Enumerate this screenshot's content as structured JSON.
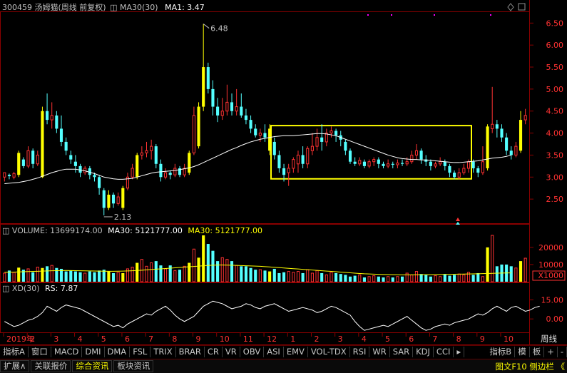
{
  "header": {
    "stock": "300459 汤姆猫(周线 前复权)",
    "ma": "MA30(30)",
    "ma1": "MA1: 3.47",
    "stock_color": "#c0c0c0",
    "ma_color": "#ffffff"
  },
  "vol_header": {
    "vol": "VOLUME: 13699174.00",
    "ma30a": "MA30: 5121777.00",
    "ma30b": "MA30: 5121777.00"
  },
  "xd_header": {
    "xd": "XD(30)",
    "rs": "RS: 7.87"
  },
  "time_tab": "周线",
  "toolbar": {
    "left": [
      "指标A",
      "窗口",
      "MACD",
      "DMI",
      "DMA",
      "FSL",
      "TRIX",
      "BRAR",
      "CR",
      "VR",
      "OBV",
      "ASI",
      "EMV",
      "VOL-TDX",
      "RSI",
      "WR",
      "SAR",
      "KDJ",
      "CCI"
    ],
    "right": [
      "指标B",
      "模",
      "板",
      "+",
      "-"
    ],
    "nav_icon": "triangle-right-icon"
  },
  "bottom_bar": {
    "items": [
      "扩展",
      "关联报价",
      "综合资讯",
      "板块资讯"
    ],
    "expand_icon": "caret-up-icon",
    "right": "图文F10 侧边栏 《"
  },
  "colors": {
    "up": "#ff3232",
    "down": "#54ffff",
    "highlight": "#ffff00",
    "ma": "#ffffff",
    "grid": "#8b0000"
  },
  "chart_data": [
    {
      "type": "candlestick",
      "title": "300459 汤姆猫(周线 前复权)",
      "ylim": [
        2.0,
        6.7
      ],
      "yticks": [
        "6.50",
        "6.00",
        "5.50",
        "5.00",
        "4.50",
        "4.00",
        "3.50",
        "3.00",
        "2.50"
      ],
      "annotations": [
        {
          "label": "6.48",
          "type": "max"
        },
        {
          "label": "2.13",
          "type": "min"
        }
      ],
      "xlabels": [
        "2019年",
        "2",
        "3",
        "4",
        "5",
        "6",
        "7",
        "8",
        "9",
        "10",
        "11",
        "12",
        "1",
        "2",
        "3",
        "4",
        "5",
        "6",
        "7",
        "8",
        "9",
        "10"
      ],
      "highlight_box": {
        "ymin": 2.96,
        "ymax": 4.17
      },
      "candles": [
        [
          3.0,
          3.1,
          2.9,
          3.05,
          0
        ],
        [
          3.05,
          3.02,
          2.95,
          3.08,
          0
        ],
        [
          3.0,
          3.08,
          2.95,
          3.12,
          0
        ],
        [
          3.05,
          3.55,
          3.0,
          3.6,
          1
        ],
        [
          3.4,
          3.25,
          3.2,
          3.45,
          0
        ],
        [
          3.25,
          3.6,
          3.2,
          3.7,
          0
        ],
        [
          3.6,
          3.3,
          3.2,
          3.65,
          0
        ],
        [
          3.3,
          3.5,
          3.25,
          3.6,
          0
        ],
        [
          3.0,
          4.5,
          2.98,
          4.6,
          1
        ],
        [
          4.5,
          4.3,
          4.2,
          4.9,
          0
        ],
        [
          4.3,
          4.4,
          4.1,
          4.7,
          0
        ],
        [
          4.4,
          4.1,
          4.0,
          4.5,
          0
        ],
        [
          4.1,
          3.8,
          3.7,
          4.4,
          0
        ],
        [
          3.8,
          3.6,
          3.5,
          3.9,
          0
        ],
        [
          3.5,
          3.4,
          3.3,
          3.6,
          0
        ],
        [
          3.35,
          3.25,
          3.1,
          3.5,
          0
        ],
        [
          3.25,
          3.1,
          3.0,
          3.3,
          0
        ],
        [
          3.1,
          3.2,
          3.05,
          3.25,
          0
        ],
        [
          3.2,
          3.05,
          2.95,
          3.25,
          0
        ],
        [
          3.05,
          3.0,
          2.9,
          3.1,
          0
        ],
        [
          3.0,
          2.75,
          2.6,
          3.05,
          0
        ],
        [
          2.7,
          2.3,
          2.13,
          2.75,
          0
        ],
        [
          2.3,
          2.6,
          2.25,
          2.7,
          1
        ],
        [
          2.6,
          2.4,
          2.3,
          2.65,
          0
        ],
        [
          2.4,
          2.55,
          2.35,
          2.65,
          0
        ],
        [
          2.3,
          2.75,
          2.25,
          2.8,
          1
        ],
        [
          2.75,
          3.0,
          2.7,
          3.1,
          0
        ],
        [
          3.0,
          3.2,
          2.95,
          3.3,
          0
        ],
        [
          3.0,
          3.5,
          2.95,
          3.55,
          1
        ],
        [
          3.5,
          3.55,
          3.4,
          3.7,
          0
        ],
        [
          3.55,
          3.6,
          3.45,
          3.8,
          0
        ],
        [
          3.6,
          3.7,
          3.4,
          3.85,
          0
        ],
        [
          3.7,
          3.3,
          3.2,
          3.75,
          0
        ],
        [
          3.3,
          3.0,
          2.9,
          3.4,
          0
        ],
        [
          3.0,
          3.1,
          2.95,
          3.2,
          0
        ],
        [
          3.1,
          3.05,
          2.95,
          3.15,
          0
        ],
        [
          3.05,
          3.2,
          3.0,
          3.3,
          0
        ],
        [
          3.2,
          3.05,
          3.0,
          3.25,
          0
        ],
        [
          3.05,
          3.2,
          3.0,
          3.3,
          0
        ],
        [
          3.1,
          3.55,
          3.05,
          3.6,
          1
        ],
        [
          3.55,
          4.4,
          3.5,
          4.6,
          0
        ],
        [
          3.7,
          4.6,
          3.65,
          4.7,
          1
        ],
        [
          4.6,
          5.5,
          4.5,
          6.48,
          1
        ],
        [
          5.5,
          5.0,
          4.9,
          5.6,
          0
        ],
        [
          5.0,
          4.6,
          4.4,
          5.2,
          0
        ],
        [
          4.6,
          4.4,
          4.25,
          4.8,
          0
        ],
        [
          4.4,
          4.5,
          4.3,
          4.8,
          0
        ],
        [
          4.5,
          4.7,
          4.4,
          5.1,
          0
        ],
        [
          4.7,
          4.5,
          4.4,
          4.9,
          0
        ],
        [
          4.5,
          4.6,
          4.4,
          5.0,
          0
        ],
        [
          4.6,
          4.4,
          4.35,
          4.9,
          0
        ],
        [
          4.4,
          4.3,
          4.2,
          4.55,
          0
        ],
        [
          4.3,
          4.1,
          4.0,
          4.4,
          0
        ],
        [
          4.1,
          3.95,
          3.9,
          4.2,
          0
        ],
        [
          3.95,
          4.0,
          3.8,
          4.1,
          0
        ],
        [
          4.0,
          3.9,
          3.8,
          4.2,
          0
        ],
        [
          3.6,
          4.1,
          3.5,
          4.2,
          1
        ],
        [
          3.8,
          3.5,
          3.4,
          3.9,
          0
        ],
        [
          3.5,
          3.2,
          3.1,
          3.6,
          0
        ],
        [
          3.2,
          3.05,
          2.9,
          3.3,
          0
        ],
        [
          3.1,
          3.2,
          2.8,
          3.3,
          0
        ],
        [
          3.2,
          3.4,
          3.1,
          3.45,
          0
        ],
        [
          3.3,
          3.5,
          3.1,
          3.6,
          0
        ],
        [
          3.5,
          3.3,
          3.2,
          3.7,
          0
        ],
        [
          3.3,
          3.65,
          3.2,
          3.7,
          0
        ],
        [
          3.6,
          3.7,
          3.5,
          4.0,
          0
        ],
        [
          3.7,
          3.9,
          3.6,
          4.1,
          0
        ],
        [
          3.9,
          3.8,
          3.6,
          4.2,
          0
        ],
        [
          3.8,
          4.0,
          3.7,
          4.1,
          0
        ],
        [
          4.0,
          4.05,
          3.9,
          4.15,
          0
        ],
        [
          4.05,
          3.95,
          3.8,
          4.1,
          0
        ],
        [
          3.95,
          3.85,
          3.7,
          4.05,
          0
        ],
        [
          3.8,
          3.6,
          3.5,
          3.85,
          0
        ],
        [
          3.6,
          3.35,
          3.3,
          3.65,
          0
        ],
        [
          3.35,
          3.3,
          3.25,
          3.45,
          0
        ],
        [
          3.3,
          3.38,
          3.25,
          3.45,
          0
        ],
        [
          3.35,
          3.25,
          3.2,
          3.4,
          0
        ],
        [
          3.25,
          3.35,
          3.2,
          3.4,
          0
        ],
        [
          3.35,
          3.4,
          3.25,
          3.45,
          0
        ],
        [
          3.4,
          3.3,
          3.2,
          3.45,
          0
        ],
        [
          3.3,
          3.25,
          3.2,
          3.35,
          0
        ],
        [
          3.25,
          3.3,
          3.2,
          3.4,
          0
        ],
        [
          3.3,
          3.28,
          3.2,
          3.35,
          0
        ],
        [
          3.28,
          3.32,
          3.2,
          3.4,
          0
        ],
        [
          3.32,
          3.3,
          3.25,
          3.4,
          0
        ],
        [
          3.3,
          3.35,
          3.25,
          3.45,
          0
        ],
        [
          3.35,
          3.5,
          3.3,
          3.6,
          0
        ],
        [
          3.5,
          3.6,
          3.4,
          3.75,
          0
        ],
        [
          3.6,
          3.4,
          3.3,
          3.65,
          0
        ],
        [
          3.4,
          3.35,
          3.25,
          3.5,
          0
        ],
        [
          3.35,
          3.25,
          3.15,
          3.4,
          0
        ],
        [
          3.25,
          3.3,
          3.2,
          3.35,
          0
        ],
        [
          3.3,
          3.35,
          3.25,
          3.45,
          0
        ],
        [
          3.35,
          3.25,
          3.15,
          3.4,
          0
        ],
        [
          3.25,
          3.1,
          3.0,
          3.3,
          0
        ],
        [
          3.1,
          3.0,
          2.95,
          3.15,
          0
        ],
        [
          3.0,
          3.1,
          2.95,
          3.2,
          0
        ],
        [
          3.1,
          3.2,
          3.05,
          3.3,
          0
        ],
        [
          3.2,
          3.35,
          3.1,
          3.4,
          0
        ],
        [
          3.35,
          3.2,
          3.1,
          3.4,
          0
        ],
        [
          3.2,
          3.1,
          3.0,
          3.25,
          0
        ],
        [
          3.1,
          3.35,
          3.05,
          3.7,
          0
        ],
        [
          3.2,
          4.15,
          3.15,
          4.2,
          1
        ],
        [
          4.1,
          4.2,
          4.0,
          5.05,
          0
        ],
        [
          4.2,
          4.1,
          3.9,
          4.3,
          0
        ],
        [
          4.1,
          3.9,
          3.8,
          4.2,
          0
        ],
        [
          3.9,
          3.6,
          3.5,
          4.0,
          0
        ],
        [
          3.6,
          3.5,
          3.4,
          3.7,
          0
        ],
        [
          3.5,
          3.7,
          3.45,
          3.8,
          0
        ],
        [
          3.6,
          4.3,
          3.55,
          4.5,
          1
        ],
        [
          4.3,
          4.4,
          4.2,
          4.55,
          0
        ]
      ],
      "ma30": [
        2.85,
        2.86,
        2.87,
        2.88,
        2.9,
        2.92,
        2.95,
        2.98,
        3.02,
        3.06,
        3.1,
        3.13,
        3.16,
        3.18,
        3.18,
        3.18,
        3.16,
        3.14,
        3.11,
        3.08,
        3.04,
        3.0,
        2.98,
        2.96,
        2.95,
        2.95,
        2.96,
        2.97,
        3.0,
        3.03,
        3.06,
        3.09,
        3.11,
        3.12,
        3.13,
        3.14,
        3.15,
        3.17,
        3.19,
        3.21,
        3.24,
        3.28,
        3.33,
        3.38,
        3.43,
        3.48,
        3.53,
        3.58,
        3.63,
        3.67,
        3.72,
        3.76,
        3.8,
        3.83,
        3.86,
        3.88,
        3.9,
        3.92,
        3.93,
        3.94,
        3.94,
        3.94,
        3.95,
        3.96,
        3.97,
        3.98,
        3.99,
        3.99,
        3.98,
        3.96,
        3.94,
        3.9,
        3.86,
        3.82,
        3.78,
        3.74,
        3.7,
        3.66,
        3.62,
        3.58,
        3.54,
        3.5,
        3.47,
        3.44,
        3.42,
        3.41,
        3.4,
        3.4,
        3.39,
        3.39,
        3.38,
        3.37,
        3.36,
        3.35,
        3.34,
        3.33,
        3.33,
        3.34,
        3.35,
        3.36,
        3.37,
        3.39,
        3.41,
        3.43,
        3.44,
        3.45,
        3.47,
        3.5
      ]
    },
    {
      "type": "bar",
      "title": "VOLUME",
      "ylim": [
        0,
        27000
      ],
      "yticks": [
        "20000",
        "10000",
        "X1000"
      ],
      "values_k": [
        5000,
        6500,
        5500,
        8200,
        7000,
        7500,
        5500,
        8500,
        8000,
        9000,
        9500,
        8000,
        7500,
        6000,
        6500,
        6000,
        5500,
        5000,
        6000,
        5500,
        6500,
        7000,
        6000,
        5000,
        5500,
        5000,
        7500,
        8500,
        11000,
        13000,
        9000,
        11000,
        12000,
        9500,
        7500,
        9500,
        6500,
        7000,
        9000,
        11000,
        19000,
        14000,
        27000,
        22000,
        18000,
        12000,
        14000,
        13000,
        12000,
        9500,
        9000,
        9000,
        8000,
        7000,
        7000,
        6500,
        6000,
        7500,
        5000,
        5500,
        6000,
        5500,
        6000,
        5000,
        7000,
        5000,
        6500,
        5000,
        4000,
        5500,
        5000,
        4500,
        4000,
        3000,
        3500,
        4000,
        2500,
        3000,
        3500,
        3000,
        2500,
        3000,
        2500,
        3000,
        3000,
        5000,
        4000,
        6000,
        4500,
        4000,
        3000,
        3500,
        3000,
        4500,
        3500,
        4000,
        4500,
        4000,
        5500,
        4000,
        5000,
        3000,
        20000,
        27000,
        9000,
        10000,
        10000,
        9000,
        8000,
        12000,
        13700
      ],
      "ma30_k": [
        5500,
        5550,
        5600,
        5700,
        5800,
        5900,
        6000,
        6100,
        6200,
        6300,
        6400,
        6450,
        6500,
        6550,
        6500,
        6450,
        6400,
        6350,
        6300,
        6250,
        6200,
        6150,
        6100,
        6100,
        6150,
        6200,
        6300,
        6400,
        6550,
        6700,
        6900,
        7100,
        7300,
        7500,
        7700,
        7900,
        8100,
        8300,
        8500,
        8700,
        8900,
        9100,
        9300,
        9500,
        9600,
        9700,
        9700,
        9650,
        9600,
        9500,
        9400,
        9300,
        9200,
        9100,
        9000,
        8800,
        8600,
        8400,
        8200,
        8000,
        7800,
        7600,
        7400,
        7200,
        7000,
        6800,
        6600,
        6400,
        6200,
        6000,
        5800,
        5600,
        5400,
        5200,
        5000,
        4800,
        4600,
        4500,
        4400,
        4300,
        4200,
        4150,
        4100,
        4050,
        4000,
        4000,
        4000,
        4050,
        4100,
        4100,
        4100,
        4150,
        4200,
        4250,
        4300,
        4350,
        4400,
        4450,
        4500,
        4550,
        4600,
        4700,
        4800,
        4900,
        5000,
        5050,
        5100,
        5121
      ]
    },
    {
      "type": "line",
      "title": "XD(30)",
      "ylim": [
        -10,
        22
      ],
      "yticks": [
        "15.00",
        "0.00"
      ],
      "values": [
        -2,
        -4,
        -6,
        -5,
        -3,
        -1,
        0,
        2,
        5,
        10,
        8,
        6,
        9,
        11,
        10,
        9,
        8,
        6,
        4,
        2,
        0,
        -2,
        -4,
        -6,
        -5,
        -7,
        -4,
        -2,
        0,
        2,
        4,
        3,
        6,
        8,
        10,
        7,
        3,
        0,
        -2,
        0,
        2,
        6,
        10,
        12,
        14,
        13,
        12,
        10,
        8,
        9,
        10,
        12,
        11,
        9,
        8,
        10,
        11,
        12,
        10,
        8,
        6,
        7,
        8,
        9,
        8,
        7,
        5,
        6,
        8,
        10,
        9,
        7,
        5,
        3,
        -2,
        -6,
        -9,
        -8,
        -7,
        -6,
        -5,
        -6,
        -4,
        -2,
        0,
        2,
        -1,
        -4,
        -7,
        -9,
        -8,
        -6,
        -5,
        -4,
        -5,
        -3,
        -2,
        -1,
        0,
        2,
        4,
        3,
        5,
        8,
        10,
        8,
        6,
        9,
        10,
        8,
        6,
        7,
        9,
        10
      ]
    }
  ]
}
